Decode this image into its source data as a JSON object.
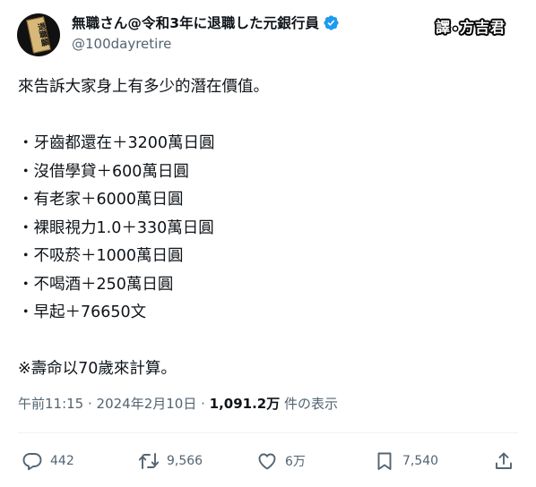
{
  "author": {
    "display_name": "無職さん@令和3年に退職した元銀行員",
    "handle": "@100dayretire",
    "avatar_text": "退職願"
  },
  "watermark": {
    "left": "譯",
    "right": "方吉君"
  },
  "tweet": {
    "lines": [
      "來告訴大家身上有多少的潛在價值。",
      "",
      "・牙齒都還在＋3200萬日圓",
      "・沒借學貸＋600萬日圓",
      "・有老家＋6000萬日圓",
      "・裸眼視力1.0＋330萬日圓",
      "・不吸菸＋1000萬日圓",
      "・不喝酒＋250萬日圓",
      "・早起＋76650文",
      "",
      "※壽命以70歲來計算。"
    ]
  },
  "meta": {
    "time_date": "午前11:15 · 2024年2月10日 · ",
    "views": "1,091.2万",
    "views_suffix": " 件の表示"
  },
  "actions": {
    "reply": {
      "count": "442",
      "icon": "reply-icon"
    },
    "retweet": {
      "count": "9,566",
      "icon": "retweet-icon"
    },
    "like": {
      "count": "6万",
      "icon": "heart-icon"
    },
    "bookmark": {
      "count": "7,540",
      "icon": "bookmark-icon"
    },
    "share": {
      "icon": "share-icon"
    }
  },
  "colors": {
    "verified": "#1d9bf0",
    "muted_text": "#536471",
    "text": "#0f1419"
  }
}
